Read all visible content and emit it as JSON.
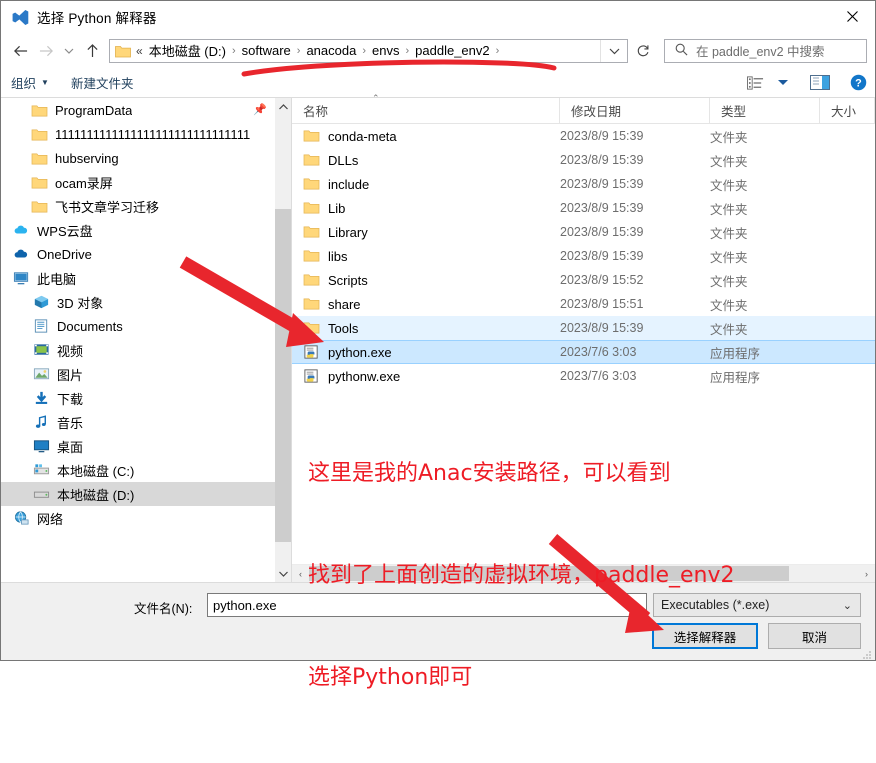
{
  "window": {
    "title": "选择 Python 解释器",
    "app_icon": "vscode-icon",
    "close_label": "✕"
  },
  "nav": {
    "back": "←",
    "forward": "→",
    "recent": "⌄",
    "up": "↑",
    "address": {
      "prefix": "«",
      "crumbs": [
        "本地磁盘 (D:)",
        "software",
        "anacoda",
        "envs",
        "paddle_env2"
      ],
      "dropdown": "⌄",
      "refresh": "↻"
    },
    "search": {
      "icon": "search-icon",
      "placeholder": "在 paddle_env2 中搜索"
    }
  },
  "commandbar": {
    "organize": "组织",
    "new_folder": "新建文件夹",
    "view_icon": "view-list-icon",
    "view_caret": "▼",
    "preview_icon": "preview-pane-icon",
    "help_icon": "help-icon"
  },
  "navpane": {
    "items": [
      {
        "label": "ProgramData",
        "icon": "folder-icon",
        "indent": 1,
        "pinned": true
      },
      {
        "label": "1111111111111111111111111111111",
        "icon": "folder-icon",
        "indent": 1,
        "pinned": false
      },
      {
        "label": "hubserving",
        "icon": "folder-icon",
        "indent": 1,
        "pinned": false
      },
      {
        "label": "ocam录屏",
        "icon": "folder-icon",
        "indent": 1,
        "pinned": false
      },
      {
        "label": "飞书文章学习迁移",
        "icon": "folder-icon",
        "indent": 1,
        "pinned": false
      },
      {
        "label": "WPS云盘",
        "icon": "cloud-wps-icon",
        "indent": 2,
        "pinned": false
      },
      {
        "label": "OneDrive",
        "icon": "cloud-onedrive-icon",
        "indent": 2,
        "pinned": false
      },
      {
        "label": "此电脑",
        "icon": "this-pc-icon",
        "indent": 2,
        "pinned": false
      },
      {
        "label": "3D 对象",
        "icon": "3d-objects-icon",
        "indent": 3,
        "pinned": false
      },
      {
        "label": "Documents",
        "icon": "documents-icon",
        "indent": 3,
        "pinned": false
      },
      {
        "label": "视频",
        "icon": "videos-icon",
        "indent": 3,
        "pinned": false
      },
      {
        "label": "图片",
        "icon": "pictures-icon",
        "indent": 3,
        "pinned": false
      },
      {
        "label": "下载",
        "icon": "downloads-icon",
        "indent": 3,
        "pinned": false
      },
      {
        "label": "音乐",
        "icon": "music-icon",
        "indent": 3,
        "pinned": false
      },
      {
        "label": "桌面",
        "icon": "desktop-icon",
        "indent": 3,
        "pinned": false
      },
      {
        "label": "本地磁盘 (C:)",
        "icon": "drive-system-icon",
        "indent": 3,
        "pinned": false
      },
      {
        "label": "本地磁盘 (D:)",
        "icon": "drive-icon",
        "indent": 3,
        "pinned": false,
        "selected": true
      },
      {
        "label": "网络",
        "icon": "network-icon",
        "indent": 2,
        "pinned": false
      }
    ]
  },
  "filepane": {
    "columns": [
      "名称",
      "修改日期",
      "类型",
      "大小"
    ],
    "sort_indicator": "⌃",
    "rows": [
      {
        "name": "conda-meta",
        "date": "2023/8/9 15:39",
        "type": "文件夹",
        "icon": "folder-icon"
      },
      {
        "name": "DLLs",
        "date": "2023/8/9 15:39",
        "type": "文件夹",
        "icon": "folder-icon"
      },
      {
        "name": "include",
        "date": "2023/8/9 15:39",
        "type": "文件夹",
        "icon": "folder-icon"
      },
      {
        "name": "Lib",
        "date": "2023/8/9 15:39",
        "type": "文件夹",
        "icon": "folder-icon"
      },
      {
        "name": "Library",
        "date": "2023/8/9 15:39",
        "type": "文件夹",
        "icon": "folder-icon"
      },
      {
        "name": "libs",
        "date": "2023/8/9 15:39",
        "type": "文件夹",
        "icon": "folder-icon"
      },
      {
        "name": "Scripts",
        "date": "2023/8/9 15:52",
        "type": "文件夹",
        "icon": "folder-icon"
      },
      {
        "name": "share",
        "date": "2023/8/9 15:51",
        "type": "文件夹",
        "icon": "folder-icon"
      },
      {
        "name": "Tools",
        "date": "2023/8/9 15:39",
        "type": "文件夹",
        "icon": "folder-icon",
        "soft": true
      },
      {
        "name": "python.exe",
        "date": "2023/7/6 3:03",
        "type": "应用程序",
        "icon": "python-exe-icon",
        "selected": true
      },
      {
        "name": "pythonw.exe",
        "date": "2023/7/6 3:03",
        "type": "应用程序",
        "icon": "python-exe-icon"
      }
    ],
    "hscroll_left": "‹",
    "hscroll_right": "›"
  },
  "bottom": {
    "filename_label": "文件名(N):",
    "filename_value": "python.exe",
    "filename_chev": "⌄",
    "filetype_value": "Executables (*.exe)",
    "filetype_chev": "⌄",
    "ok_button": "选择解释器",
    "cancel_button": "取消"
  },
  "annotations": {
    "color": "#ee1c25",
    "note_line1": "这里是我的Anac安装路径，可以看到",
    "note_line2": "找到了上面创造的虚拟环境，paddle_env2",
    "note_line3": "选择Python即可"
  }
}
